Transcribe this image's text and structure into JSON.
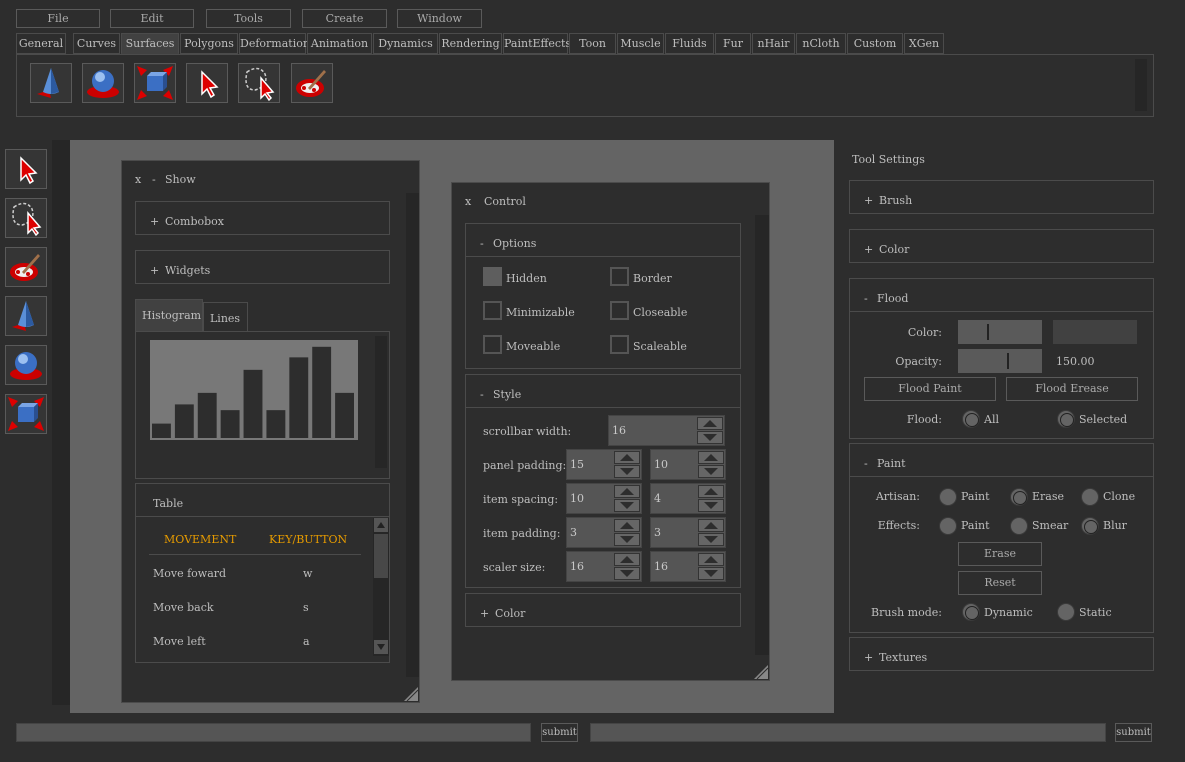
{
  "menu": [
    "File",
    "Edit",
    "Tools",
    "Create",
    "Window"
  ],
  "tabs": [
    {
      "label": "General"
    },
    {
      "label": "Curves"
    },
    {
      "label": "Surfaces",
      "active": true
    },
    {
      "label": "Polygons"
    },
    {
      "label": "Deformation"
    },
    {
      "label": "Animation"
    },
    {
      "label": "Dynamics"
    },
    {
      "label": "Rendering"
    },
    {
      "label": "PaintEffects"
    },
    {
      "label": "Toon"
    },
    {
      "label": "Muscle"
    },
    {
      "label": "Fluids"
    },
    {
      "label": "Fur"
    },
    {
      "label": "nHair"
    },
    {
      "label": "nCloth"
    },
    {
      "label": "Custom"
    },
    {
      "label": "XGen"
    }
  ],
  "shelf_icons": [
    "cone-icon",
    "sphere-icon",
    "cube-scale-icon",
    "select-arrow-icon",
    "lasso-select-icon",
    "paint-brush-icon"
  ],
  "left_tools": [
    "select-arrow-icon",
    "lasso-select-icon",
    "paint-brush-icon",
    "cone-icon",
    "sphere-icon",
    "cube-scale-icon"
  ],
  "show_window": {
    "close": "x",
    "minimize": "-",
    "title": "Show",
    "combobox": {
      "toggle": "+",
      "label": "Combobox"
    },
    "widgets": {
      "toggle": "+",
      "label": "Widgets"
    },
    "chart_tabs": [
      {
        "label": "Histogram",
        "active": true
      },
      {
        "label": "Lines"
      }
    ],
    "table": {
      "title": "Table",
      "headers": [
        "MOVEMENT",
        "KEY/BUTTON"
      ],
      "rows": [
        [
          "Move foward",
          "w"
        ],
        [
          "Move back",
          "s"
        ],
        [
          "Move left",
          "a"
        ]
      ]
    }
  },
  "chart_data": {
    "type": "bar",
    "values": [
      0.15,
      0.35,
      0.47,
      0.29,
      0.71,
      0.29,
      0.84,
      0.95,
      0.47
    ],
    "ylim": [
      0,
      1
    ],
    "title": "",
    "xlabel": "",
    "ylabel": ""
  },
  "control_window": {
    "close": "x",
    "title": "Control",
    "options": {
      "toggle": "-",
      "label": "Options",
      "checks": [
        {
          "label": "Hidden",
          "checked": true
        },
        {
          "label": "Border",
          "checked": false
        },
        {
          "label": "Minimizable",
          "checked": false
        },
        {
          "label": "Closeable",
          "checked": false
        },
        {
          "label": "Moveable",
          "checked": false
        },
        {
          "label": "Scaleable",
          "checked": false
        }
      ]
    },
    "style": {
      "toggle": "-",
      "label": "Style",
      "rows": [
        {
          "label": "scrollbar width:",
          "values": [
            "16"
          ]
        },
        {
          "label": "panel padding:",
          "values": [
            "15",
            "10"
          ]
        },
        {
          "label": "item spacing:",
          "values": [
            "10",
            "4"
          ]
        },
        {
          "label": "item padding:",
          "values": [
            "3",
            "3"
          ]
        },
        {
          "label": "scaler size:",
          "values": [
            "16",
            "16"
          ]
        }
      ]
    },
    "color": {
      "toggle": "+",
      "label": "Color"
    }
  },
  "tool_settings": {
    "title": "Tool Settings",
    "brush": {
      "toggle": "+",
      "label": "Brush"
    },
    "color": {
      "toggle": "+",
      "label": "Color"
    },
    "flood": {
      "toggle": "-",
      "label": "Flood",
      "color_label": "Color:",
      "color_level": 0.35,
      "opacity_label": "Opacity:",
      "opacity_level": 0.6,
      "opacity_value": "150.00",
      "flood_paint": "Flood Paint",
      "flood_erase": "Flood Erease",
      "flood_label": "Flood:",
      "flood_all": "All",
      "flood_selected": "Selected"
    },
    "paint": {
      "toggle": "-",
      "label": "Paint",
      "artisan_label": "Artisan:",
      "artisan_options": [
        "Paint",
        "Erase",
        "Clone"
      ],
      "effects_label": "Effects:",
      "effects_options": [
        "Paint",
        "Smear",
        "Blur"
      ],
      "erase": "Erase",
      "reset": "Reset",
      "brush_mode_label": "Brush mode:",
      "brush_modes": [
        "Dynamic",
        "Static"
      ]
    },
    "textures": {
      "toggle": "+",
      "label": "Textures"
    }
  },
  "bottom": {
    "submit_left": "submit",
    "submit_right": "submit"
  }
}
